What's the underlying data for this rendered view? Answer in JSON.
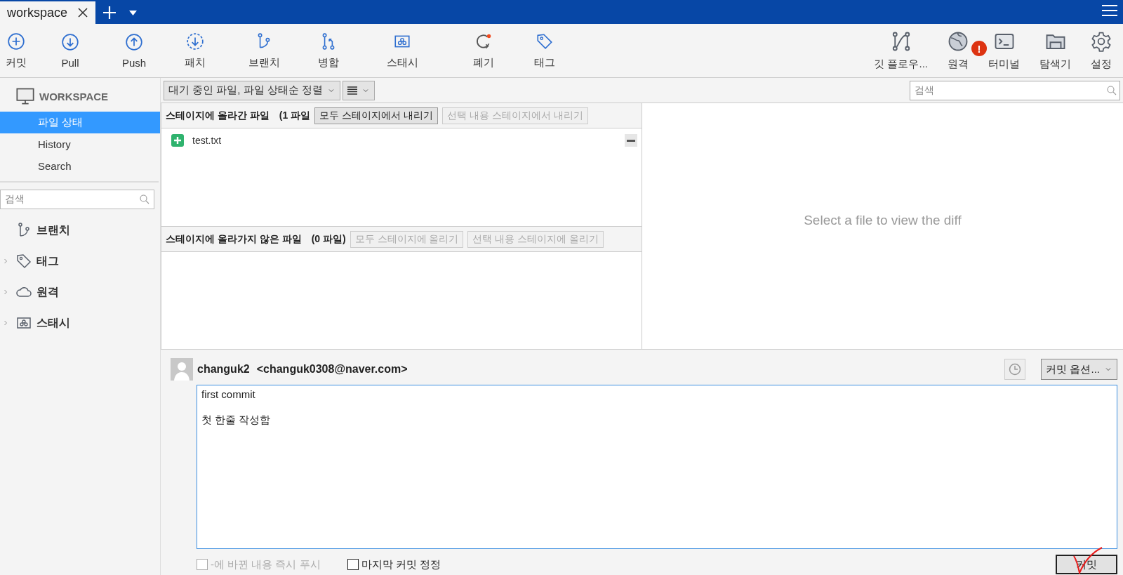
{
  "tabs": [
    {
      "label": "workspace",
      "selected": true
    }
  ],
  "toolbar": {
    "left": [
      {
        "label": "커밋"
      },
      {
        "label": "Pull"
      },
      {
        "label": "Push"
      },
      {
        "label": "패치"
      },
      {
        "label": "브랜치"
      },
      {
        "label": "병합"
      },
      {
        "label": "스태시"
      },
      {
        "label": "폐기"
      },
      {
        "label": "태그"
      }
    ],
    "right": [
      {
        "label": "깃 플로우..."
      },
      {
        "label": "원격",
        "badge": "!"
      },
      {
        "label": "터미널"
      },
      {
        "label": "탐색기"
      },
      {
        "label": "설정"
      }
    ]
  },
  "sidebar": {
    "workspace": "WORKSPACE",
    "views": [
      {
        "label": "파일 상태",
        "selected": true
      },
      {
        "label": "History",
        "selected": false
      },
      {
        "label": "Search",
        "selected": false
      }
    ],
    "search": {
      "placeholder": "검색"
    },
    "sections": [
      {
        "label": "브랜치",
        "collapsible": false
      },
      {
        "label": "태그",
        "collapsible": true
      },
      {
        "label": "원격",
        "collapsible": true
      },
      {
        "label": "스태시",
        "collapsible": true
      }
    ]
  },
  "filter": {
    "sort": "대기 중인 파일, 파일 상태순 정렬",
    "search": {
      "placeholder": "검색"
    }
  },
  "staged": {
    "title": "스테이지에 올라간 파일",
    "count": "(1 파일",
    "buttons": [
      {
        "label": "모두 스테이지에서 내리기",
        "disabled": false
      },
      {
        "label": "선택 내용 스테이지에서 내리기",
        "disabled": true
      }
    ],
    "files": [
      {
        "name": "test.txt"
      }
    ]
  },
  "unstaged": {
    "title": "스테이지에 올라가지 않은 파일",
    "count": "(0 파일)",
    "buttons": [
      {
        "label": "모두 스테이지에 올리기",
        "disabled": true
      },
      {
        "label": "선택 내용 스테이지에 올리기",
        "disabled": true
      }
    ]
  },
  "diff": {
    "message": "Select a file to view the diff"
  },
  "commit": {
    "author": "changuk2",
    "email": "<changuk0308@naver.com>",
    "options": "커밋 옵션...",
    "message": "first commit\n\n첫 한줄 작성함",
    "push_now": {
      "label": "-에 바뀐 내용 즉시 푸시",
      "checked": false,
      "disabled": true
    },
    "amend": {
      "label": "마지막 커밋 정정",
      "checked": false,
      "disabled": false
    },
    "button": "커밋"
  }
}
